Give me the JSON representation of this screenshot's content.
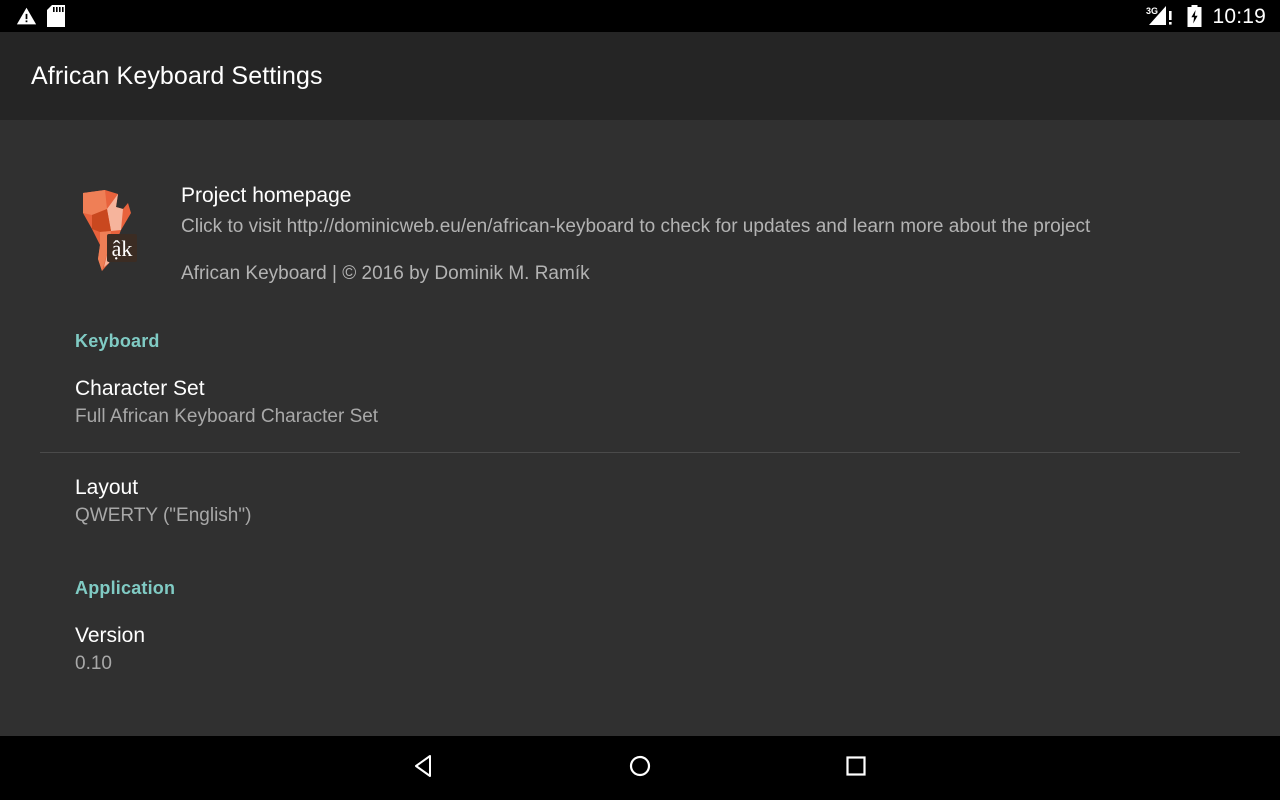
{
  "status_bar": {
    "icons_left": [
      "warning-triangle-icon",
      "sd-card-icon"
    ],
    "network_label": "3G",
    "network_alert": "!",
    "icons_right": [
      "signal-icon",
      "battery-charging-icon"
    ],
    "clock": "10:19"
  },
  "action_bar": {
    "title": "African Keyboard Settings"
  },
  "about": {
    "icon_badge_text": "ậk",
    "title": "Project homepage",
    "summary": "Click to visit http://dominicweb.eu/en/african-keyboard to check for updates and learn more about the project",
    "copyright": "African Keyboard | © 2016 by Dominik M. Ramík"
  },
  "sections": [
    {
      "header": "Keyboard",
      "items": [
        {
          "title": "Character Set",
          "summary": "Full African Keyboard Character Set"
        },
        {
          "title": "Layout",
          "summary": "QWERTY (\"English\")"
        }
      ]
    },
    {
      "header": "Application",
      "items": [
        {
          "title": "Version",
          "summary": "0.10"
        }
      ]
    }
  ],
  "nav_bar": {
    "back": "back-button",
    "home": "home-button",
    "recents": "recents-button"
  },
  "colors": {
    "accent": "#80cbc4",
    "background": "#303030",
    "action_bar": "#252525",
    "icon_orange": "#e8623c"
  }
}
